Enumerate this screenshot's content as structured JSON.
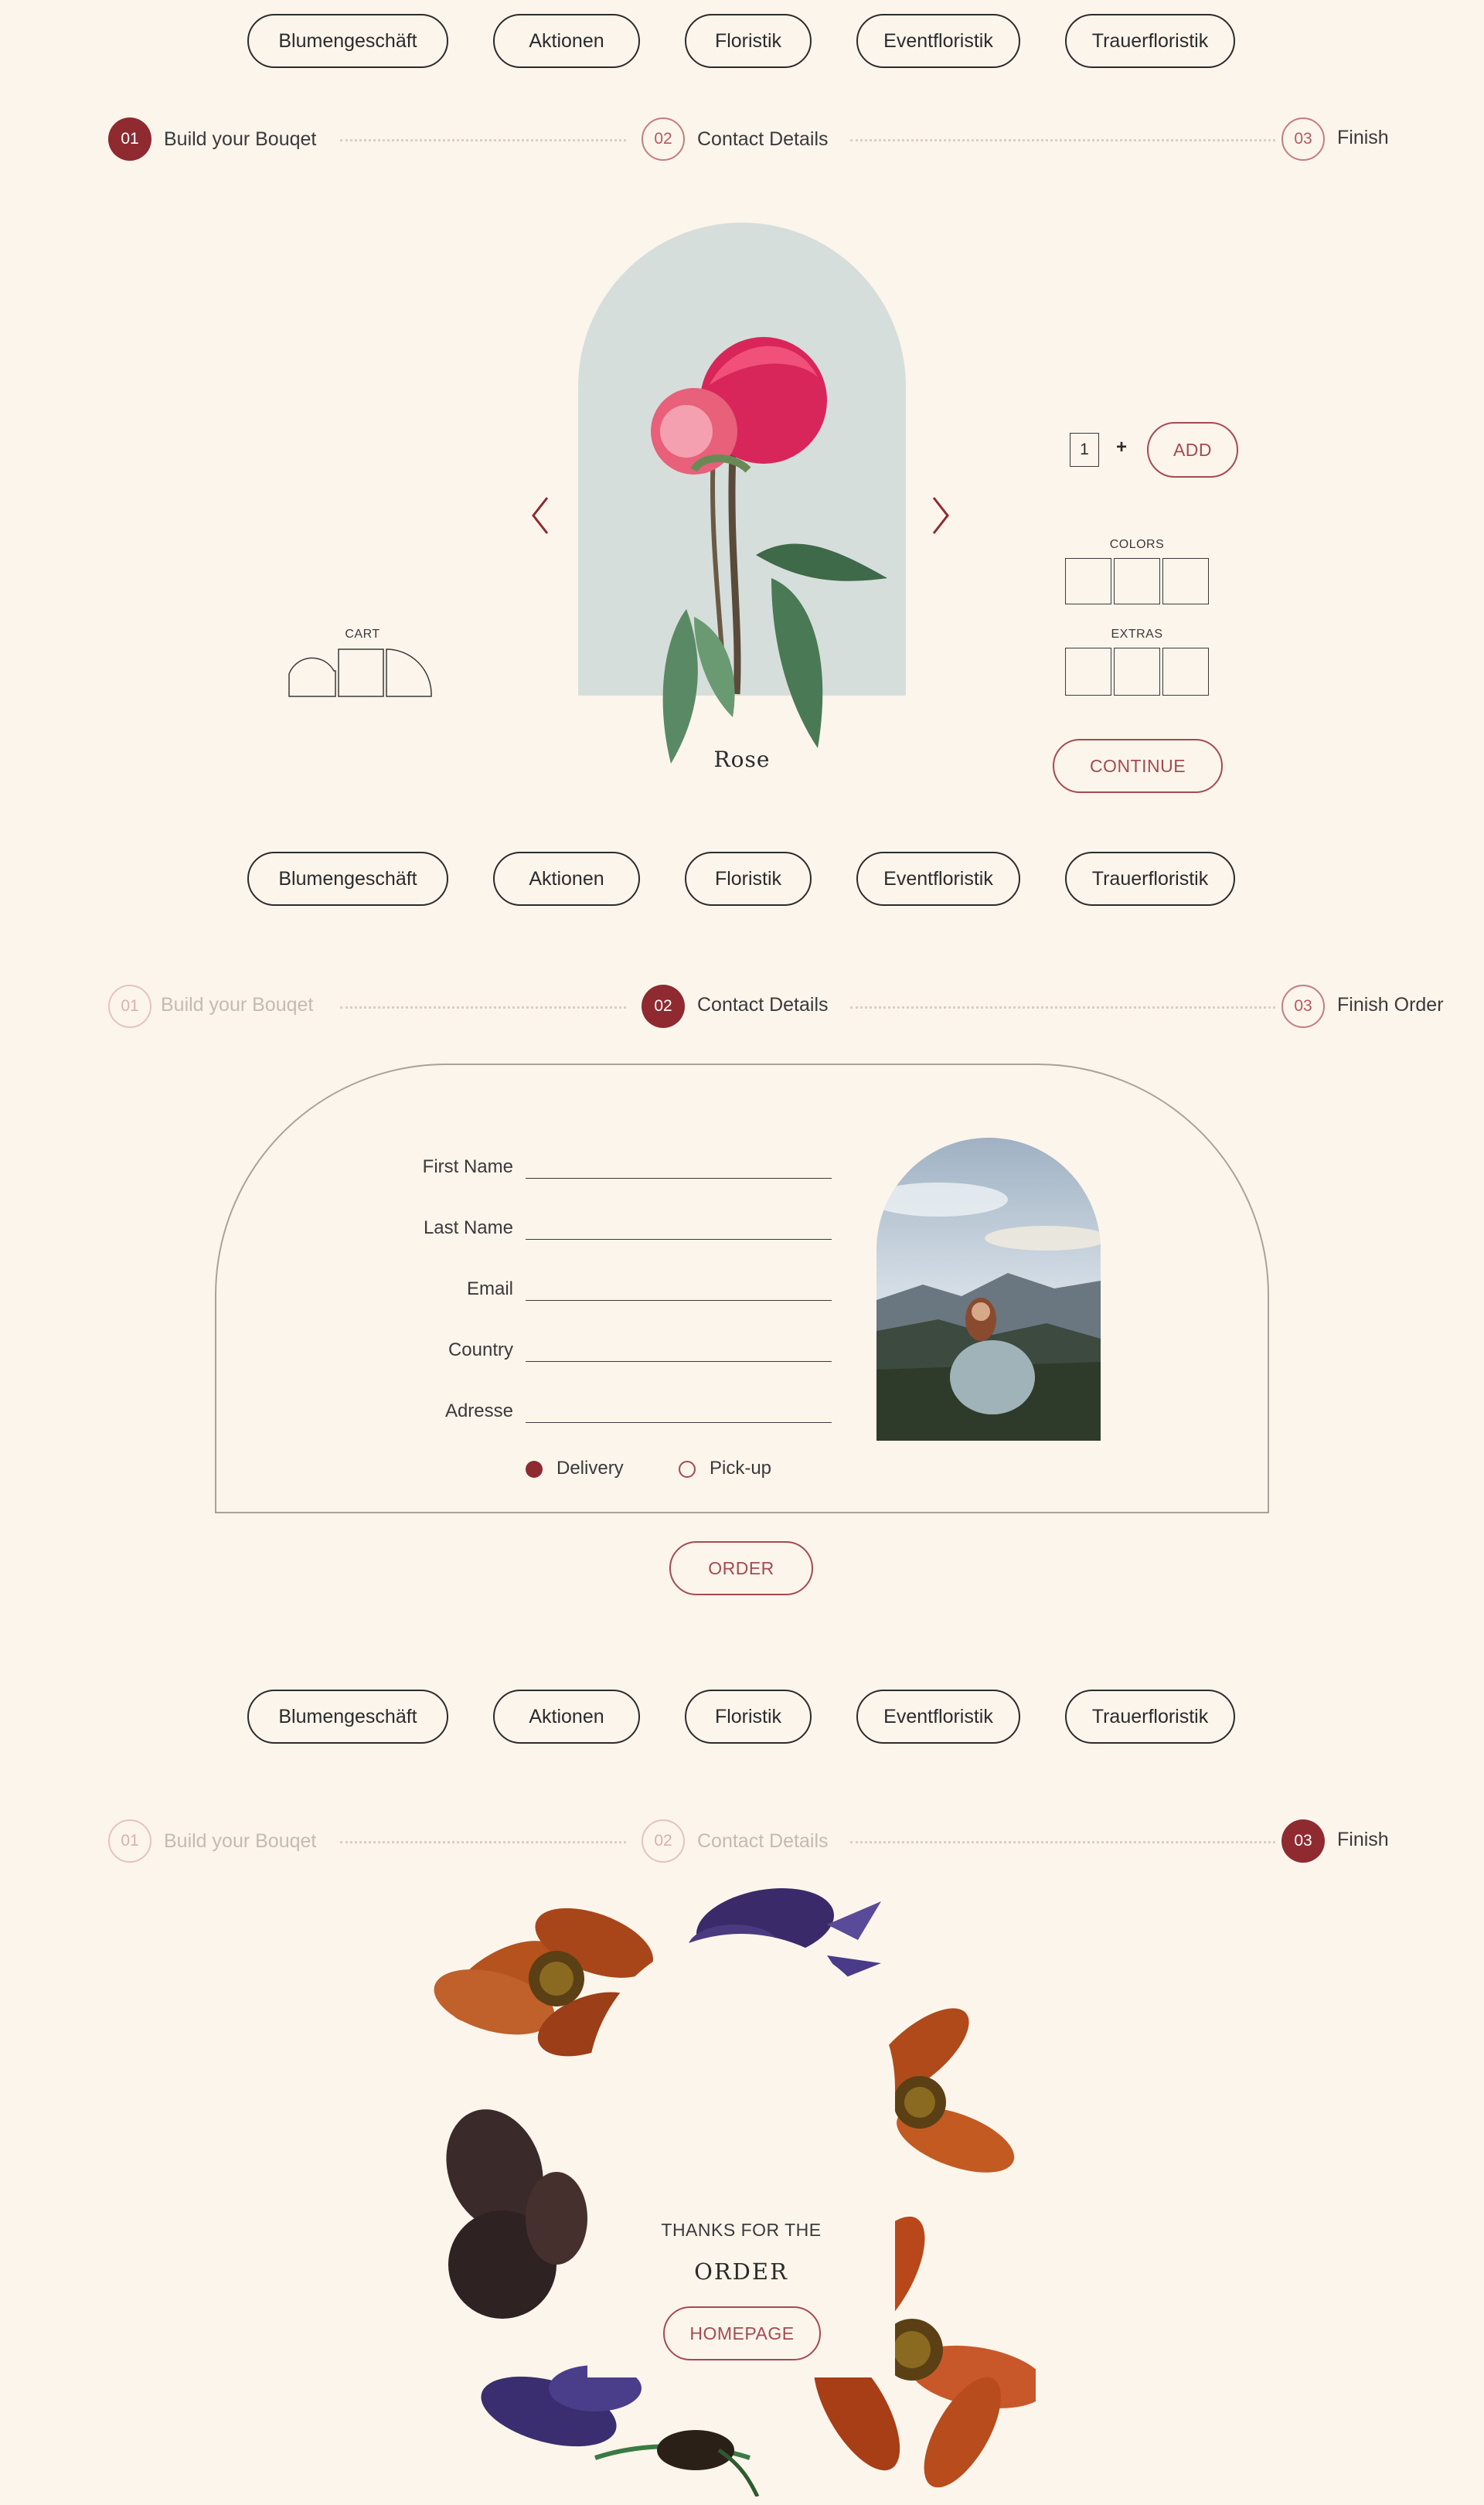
{
  "nav": {
    "items": [
      {
        "label": "Blumengeschäft"
      },
      {
        "label": "Aktionen"
      },
      {
        "label": "Floristik"
      },
      {
        "label": "Eventfloristik"
      },
      {
        "label": "Trauerfloristik"
      }
    ]
  },
  "section1": {
    "steps": [
      {
        "num": "01",
        "label": "Build your Bouqet"
      },
      {
        "num": "02",
        "label": "Contact Details"
      },
      {
        "num": "03",
        "label": "Finish"
      }
    ],
    "product_name": "Rose",
    "quantity": "1",
    "plus": "+",
    "add_label": "ADD",
    "colors_label": "COLORS",
    "extras_label": "EXTRAS",
    "cart_label": "CART",
    "continue_label": "CONTINUE"
  },
  "section2": {
    "steps": [
      {
        "num": "01",
        "label": "Build your Bouqet"
      },
      {
        "num": "02",
        "label": "Contact Details"
      },
      {
        "num": "03",
        "label": "Finish Order"
      }
    ],
    "fields": [
      {
        "label": "First Name"
      },
      {
        "label": "Last Name"
      },
      {
        "label": "Email"
      },
      {
        "label": "Country"
      },
      {
        "label": "Adresse"
      }
    ],
    "delivery_label": "Delivery",
    "pickup_label": "Pick-up",
    "order_label": "ORDER"
  },
  "section3": {
    "steps": [
      {
        "num": "01",
        "label": "Build your Bouqet"
      },
      {
        "num": "02",
        "label": "Contact Details"
      },
      {
        "num": "03",
        "label": "Finish"
      }
    ],
    "thanks": "THANKS FOR THE",
    "order": "ORDER",
    "homepage_label": "HOMEPAGE"
  },
  "colors": {
    "background": "#fcf5ec",
    "accent": "#8e2a30",
    "button_outline": "#a64a50",
    "arch_bg": "#d6dedc"
  }
}
